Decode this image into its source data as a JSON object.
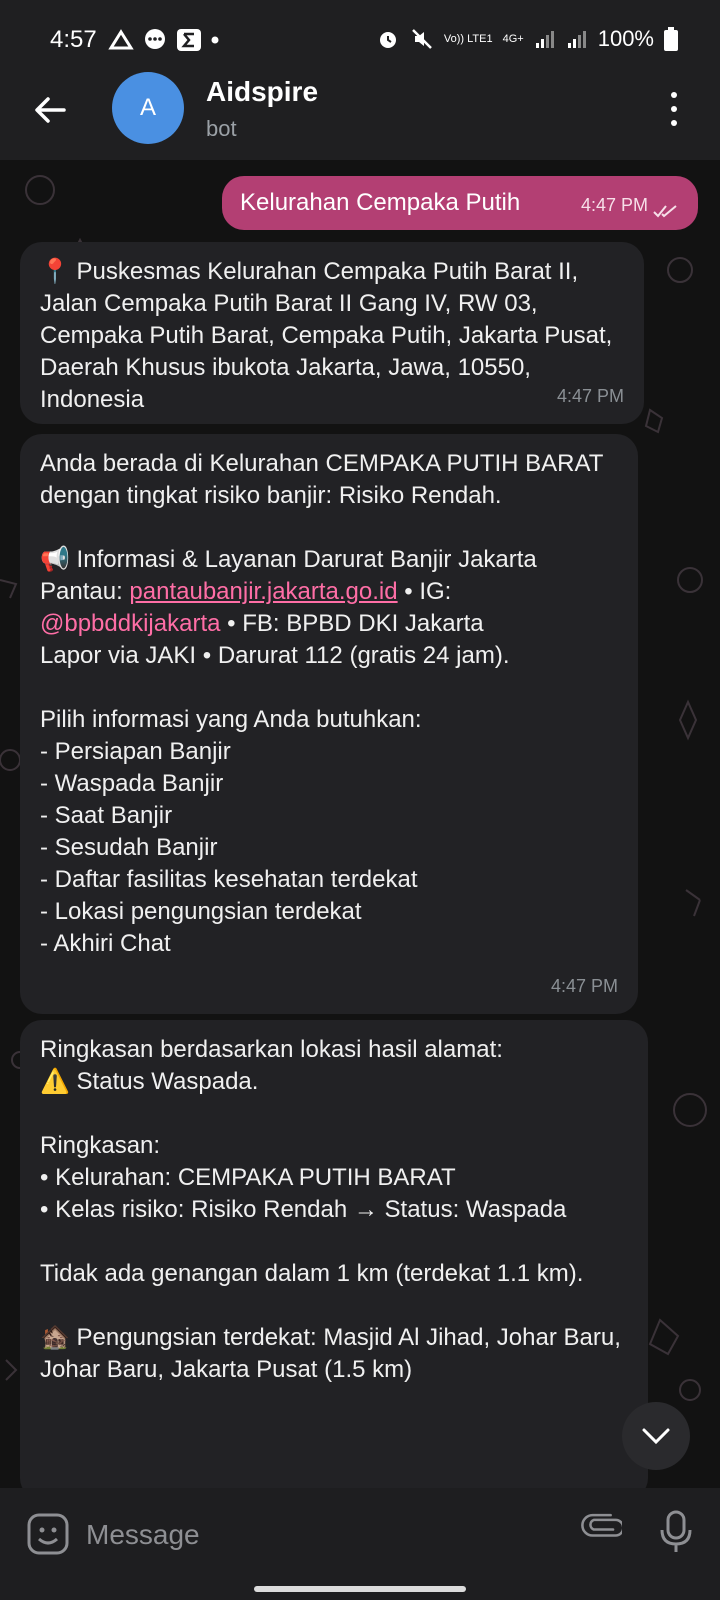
{
  "status_bar": {
    "time": "4:57",
    "left_icons": [
      "drive-icon",
      "chat-icon",
      "sigma-icon",
      "dot-icon"
    ],
    "right_icons": [
      "alarm-icon",
      "mute-icon",
      "volte-icon",
      "4g-plus-icon",
      "signal-icon",
      "signal-icon-2"
    ],
    "network_label": "Vo)) LTE1",
    "network_4g": "4G+",
    "battery": "100%"
  },
  "app_bar": {
    "avatar_letter": "A",
    "title": "Aidspire",
    "subtitle": "bot"
  },
  "messages": {
    "outgoing": {
      "text": "Kelurahan Cempaka Putih",
      "time": "4:47 PM"
    },
    "m1": {
      "text": "📍 Puskesmas Kelurahan Cempaka Putih Barat II, Jalan Cempaka Putih Barat II Gang IV, RW 03, Cempaka Putih Barat, Cempaka Putih, Jakarta Pusat, Daerah Khusus ibukota Jakarta, Jawa, 10550, Indonesia",
      "time": "4:47 PM"
    },
    "m2": {
      "intro": "Anda berada di Kelurahan CEMPAKA PUTIH BARAT dengan tingkat risiko banjir: Risiko Rendah.",
      "info_heading": "📢 Informasi & Layanan Darurat Banjir Jakarta",
      "pantau_label": "Pantau: ",
      "pantau_link": "pantaubanjir.jakarta.go.id",
      "ig_label": " • IG: ",
      "ig_handle": "@bpbddkijakarta",
      "fb_text": " • FB: BPBD DKI Jakarta",
      "lapor_text": "Lapor via JAKI • Darurat 112 (gratis 24 jam).",
      "options_heading": "Pilih informasi yang Anda butuhkan:",
      "options": [
        "- Persiapan Banjir",
        "- Waspada Banjir",
        "- Saat Banjir",
        "- Sesudah Banjir",
        "- Daftar fasilitas kesehatan terdekat",
        "- Lokasi pengungsian terdekat",
        "- Akhiri Chat"
      ],
      "time": "4:47 PM"
    },
    "m3": {
      "line1": "Ringkasan berdasarkan lokasi hasil alamat:",
      "line2": "⚠️ Status Waspada.",
      "summary_heading": "Ringkasan:",
      "bullet1": "• Kelurahan: CEMPAKA PUTIH BARAT",
      "bullet2": "• Kelas risiko: Risiko Rendah → Status: Waspada",
      "genangan": "Tidak ada genangan dalam 1 km (terdekat 1.1 km).",
      "pengungsian": "🏚️ Pengungsian terdekat: Masjid Al Jihad, Johar Baru, Johar Baru, Jakarta Pusat (1.5 km)"
    }
  },
  "composer": {
    "placeholder": "Message"
  },
  "colors": {
    "outgoing_bubble": "#b33f73",
    "incoming_bubble": "#222225",
    "link": "#ff6ea6",
    "avatar": "#4a90e2"
  }
}
